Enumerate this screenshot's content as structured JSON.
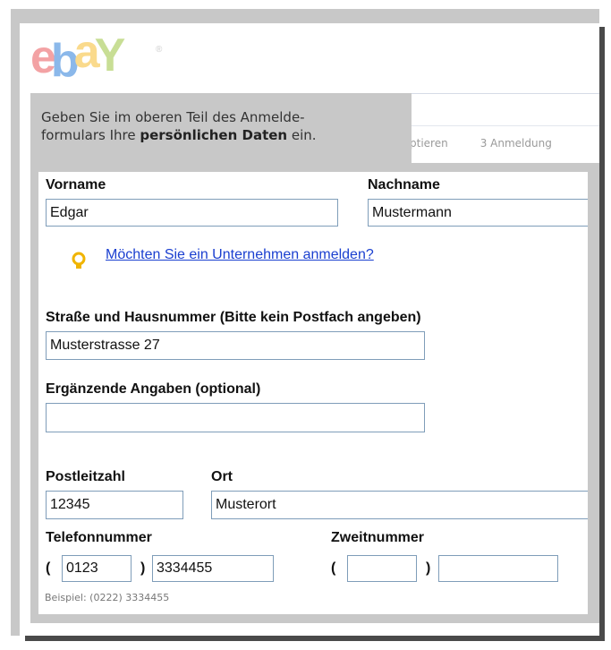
{
  "logo": {
    "letters": [
      "e",
      "b",
      "a",
      "Y"
    ],
    "colors": [
      "#e53238",
      "#0064d2",
      "#f5af02",
      "#86b817"
    ],
    "registered": "®"
  },
  "header": {
    "steps_partial": "ptieren",
    "step3": "3  Anmeldung"
  },
  "callout": {
    "line1": "Geben Sie im oberen Teil des Anmelde-",
    "line2_prefix": "formulars Ihre ",
    "line2_bold": "persönlichen Daten",
    "line2_suffix": " ein."
  },
  "form": {
    "vorname": {
      "label": "Vorname",
      "value": "Edgar"
    },
    "nachname": {
      "label": "Nachname",
      "value": "Mustermann"
    },
    "company_link": "Möchten Sie ein Unternehmen anmelden?",
    "strasse": {
      "label": "Straße und Hausnummer (Bitte kein Postfach angeben)",
      "value": "Musterstrasse 27"
    },
    "ergaenzung": {
      "label": "Ergänzende Angaben (optional)",
      "value": ""
    },
    "plz": {
      "label": "Postleitzahl",
      "value": "12345"
    },
    "ort": {
      "label": "Ort",
      "value": "Musterort"
    },
    "telefon": {
      "label": "Telefonnummer",
      "area": "0123",
      "number": "3334455"
    },
    "zweitnummer": {
      "label": "Zweitnummer",
      "area": "",
      "number": ""
    },
    "paren_open": "(",
    "paren_close": ")",
    "example": "Beispiel: (0222) 3334455"
  },
  "colors": {
    "frame": "#c8c8c8",
    "shadow": "#4a4a4a",
    "link": "#1a3fd0",
    "field_border": "#7f9db9",
    "bulb": "#f0b400"
  },
  "icons": {
    "hint": "lightbulb-icon"
  }
}
